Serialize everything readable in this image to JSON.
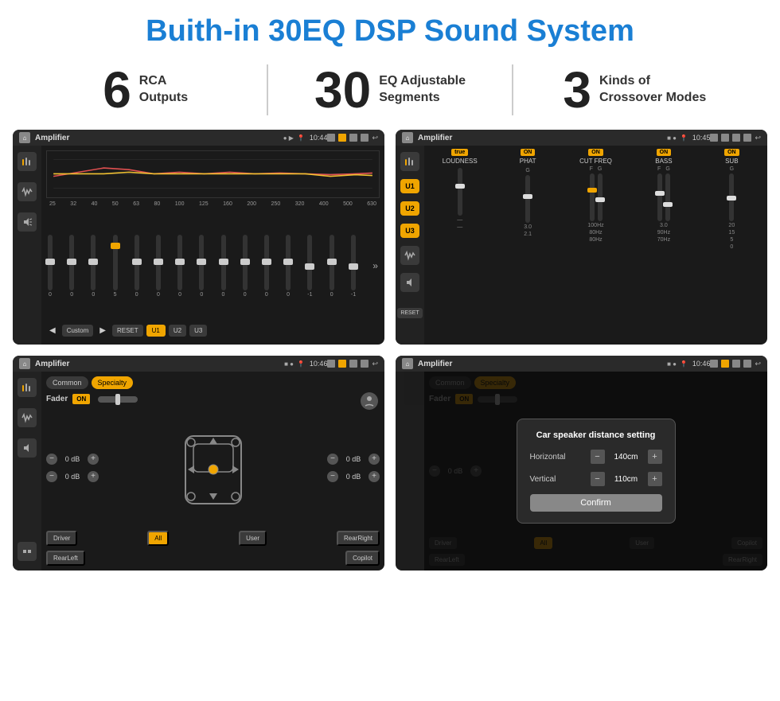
{
  "page": {
    "title": "Buith-in 30EQ DSP Sound System",
    "stats": [
      {
        "number": "6",
        "label": "RCA\nOutputs"
      },
      {
        "number": "30",
        "label": "EQ Adjustable\nSegments"
      },
      {
        "number": "3",
        "label": "Kinds of\nCrossover Modes"
      }
    ],
    "screens": [
      {
        "id": "screen1",
        "status_bar": {
          "title": "Amplifier",
          "time": "10:44"
        },
        "eq_frequencies": [
          "25",
          "32",
          "40",
          "50",
          "63",
          "80",
          "100",
          "125",
          "160",
          "200",
          "250",
          "320",
          "400",
          "500",
          "630"
        ],
        "eq_values": [
          "0",
          "0",
          "0",
          "5",
          "0",
          "0",
          "0",
          "0",
          "0",
          "0",
          "0",
          "0",
          "-1",
          "0",
          "-1"
        ],
        "preset": "Custom",
        "buttons": [
          "RESET",
          "U1",
          "U2",
          "U3"
        ]
      },
      {
        "id": "screen2",
        "status_bar": {
          "title": "Amplifier",
          "time": "10:45"
        },
        "u_buttons": [
          "U1",
          "U2",
          "U3"
        ],
        "sections": [
          {
            "label": "LOUDNESS",
            "on": true
          },
          {
            "label": "PHAT",
            "on": true
          },
          {
            "label": "CUT FREQ",
            "on": true
          },
          {
            "label": "BASS",
            "on": true
          },
          {
            "label": "SUB",
            "on": true
          }
        ],
        "reset": "RESET"
      },
      {
        "id": "screen3",
        "status_bar": {
          "title": "Amplifier",
          "time": "10:46"
        },
        "tabs": [
          "Common",
          "Specialty"
        ],
        "fader_label": "Fader",
        "fader_on": "ON",
        "db_values": [
          "0 dB",
          "0 dB",
          "0 dB",
          "0 dB"
        ],
        "bottom_buttons": [
          "Driver",
          "All",
          "User",
          "RearRight",
          "RearLeft",
          "Copilot"
        ]
      },
      {
        "id": "screen4",
        "status_bar": {
          "title": "Amplifier",
          "time": "10:46"
        },
        "tabs": [
          "Common",
          "Specialty"
        ],
        "dialog": {
          "title": "Car speaker distance setting",
          "horizontal_label": "Horizontal",
          "horizontal_value": "140cm",
          "vertical_label": "Vertical",
          "vertical_value": "110cm",
          "confirm_label": "Confirm"
        },
        "db_values": [
          "0 dB",
          "0 dB"
        ],
        "bottom_buttons": [
          "Driver",
          "RearLeft",
          "All",
          "User",
          "RearRight",
          "Copilot"
        ]
      }
    ]
  }
}
